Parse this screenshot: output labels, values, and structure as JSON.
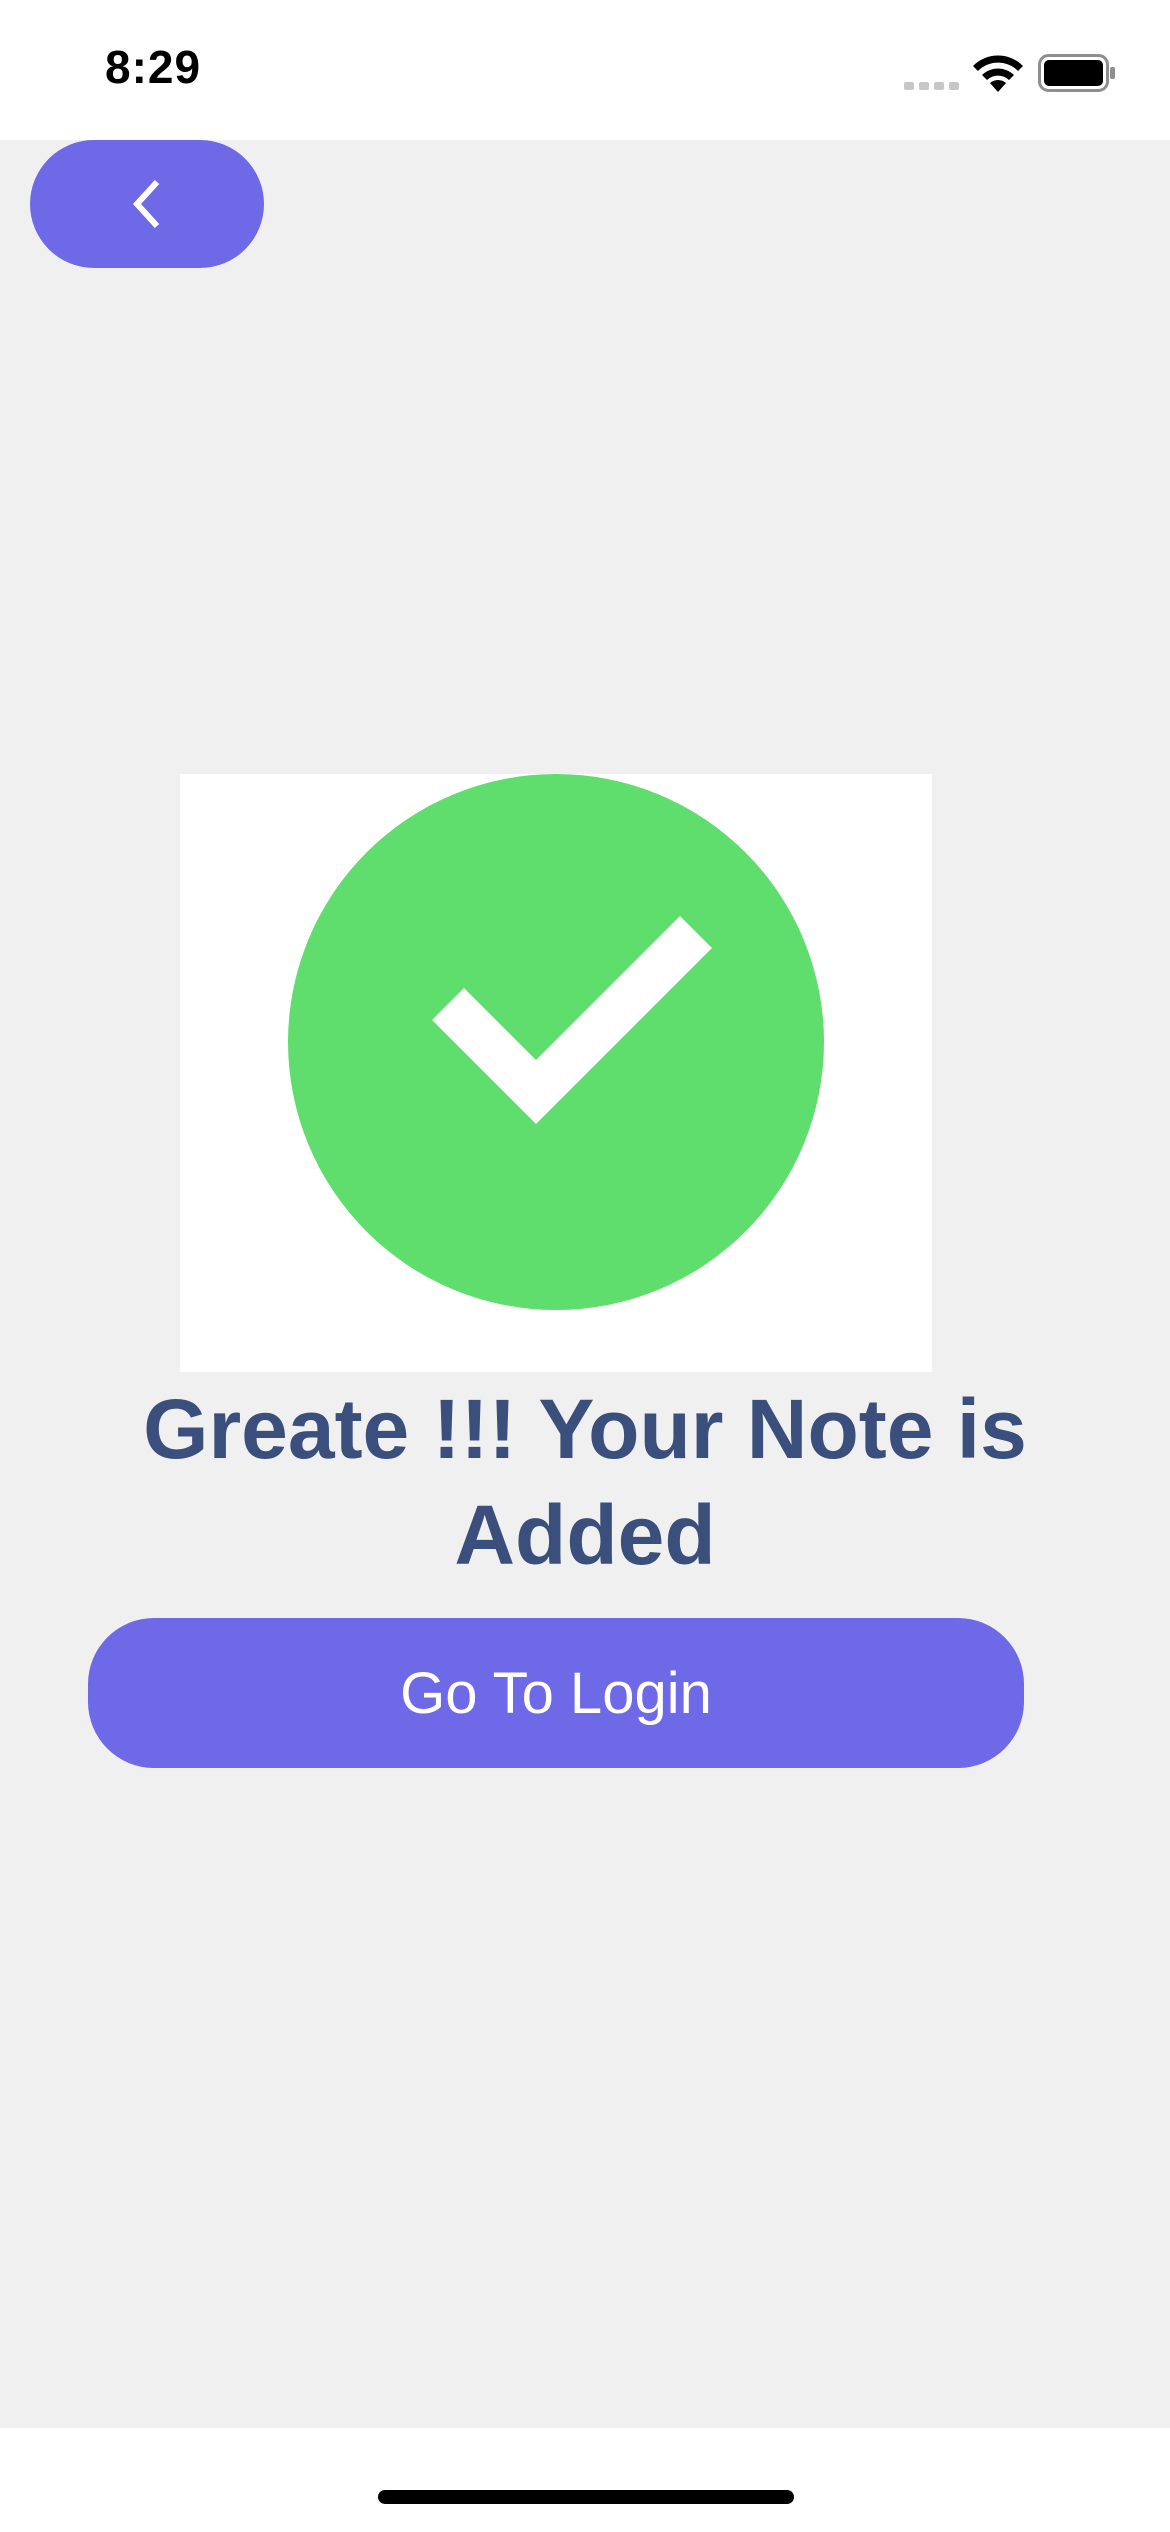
{
  "status_bar": {
    "time": "8:29"
  },
  "icons": {
    "back": "chevron-left-icon",
    "success": "checkmark-circle-icon",
    "signal": "signal-icon",
    "wifi": "wifi-icon",
    "battery": "battery-icon"
  },
  "main": {
    "message": "Greate !!! Your Note is Added",
    "login_button_label": "Go To Login"
  },
  "colors": {
    "accent": "#6e69e6",
    "success_green": "#5fdd6d",
    "message_text": "#3b4f7c",
    "background": "#f0f0f0"
  }
}
